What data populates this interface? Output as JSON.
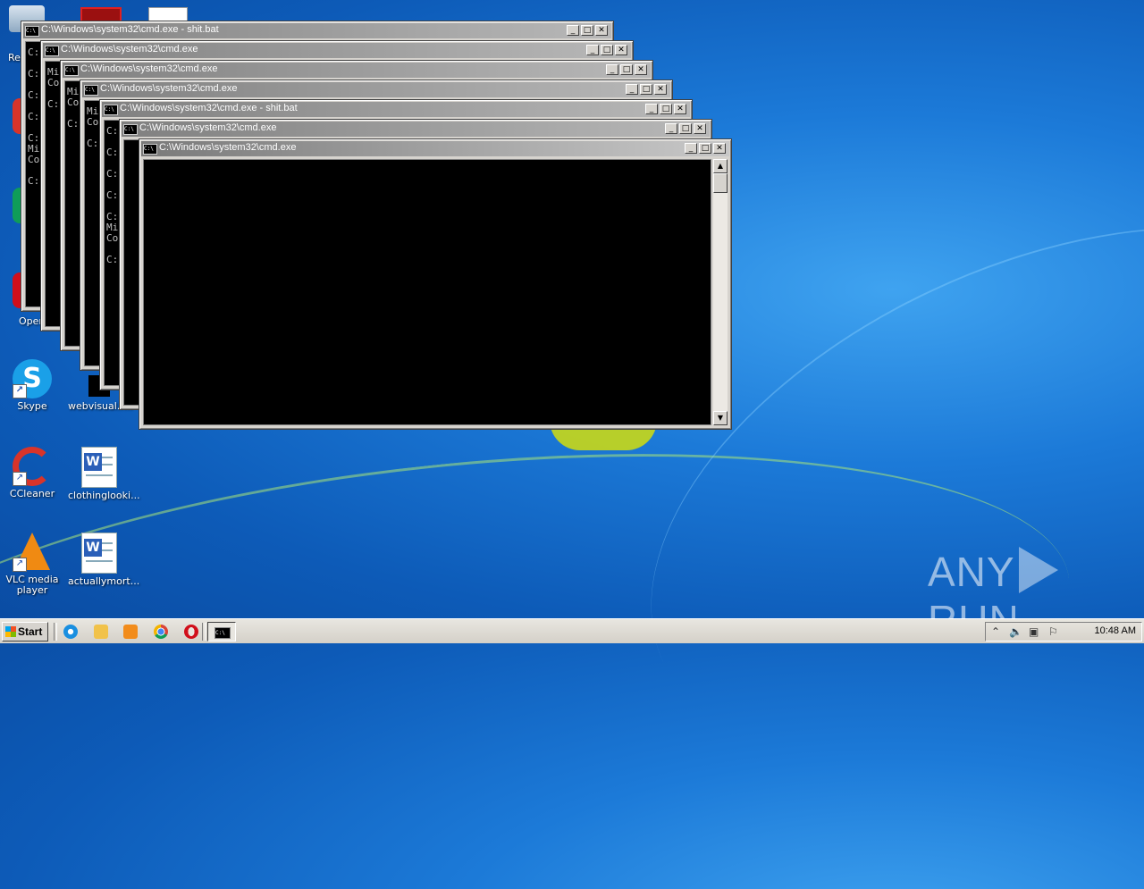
{
  "desktop": {
    "icons": [
      {
        "label": "Skype",
        "icon": "skype-icon"
      },
      {
        "label": "webvisual.r...",
        "icon": "file-icon"
      },
      {
        "label": "CCleaner",
        "icon": "ccleaner-icon"
      },
      {
        "label": "clothinglooki...",
        "icon": "word-document-icon"
      },
      {
        "label": "VLC media player",
        "icon": "vlc-icon"
      },
      {
        "label": "actuallymort...",
        "icon": "word-document-icon"
      }
    ],
    "partial_labels": [
      "Re",
      "Oper"
    ]
  },
  "windows": [
    {
      "title": "C:\\Windows\\system32\\cmd.exe - shit.bat",
      "lines": "C:\n\nC:\n\nC:\n\nC:\n\nC:\nMi\nCo\n\nC:"
    },
    {
      "title": "C:\\Windows\\system32\\cmd.exe",
      "lines": "Mi\nCo\n\nC:"
    },
    {
      "title": "C:\\Windows\\system32\\cmd.exe",
      "lines": "Mi\nCo\n\nC:"
    },
    {
      "title": "C:\\Windows\\system32\\cmd.exe",
      "lines": "Mi\nCo\n\nC:"
    },
    {
      "title": "C:\\Windows\\system32\\cmd.exe - shit.bat",
      "lines": "C:\n\nC:\n\nC:\n\nC:\n\nC:\nMi\nCo\n\nC:"
    },
    {
      "title": "C:\\Windows\\system32\\cmd.exe",
      "lines": ""
    },
    {
      "title": "C:\\Windows\\system32\\cmd.exe",
      "lines": ""
    }
  ],
  "window_buttons": {
    "minimize": "_",
    "maximize": "□",
    "close": "✕"
  },
  "taskbar": {
    "start_label": "Start",
    "quick_launch": [
      "ie-icon",
      "folder-icon",
      "media-player-icon",
      "chrome-icon",
      "opera-icon"
    ],
    "active_task_icon": "cmd-icon",
    "clock": "10:48 AM"
  },
  "watermark": {
    "left": "ANY",
    "right": "RUN"
  }
}
